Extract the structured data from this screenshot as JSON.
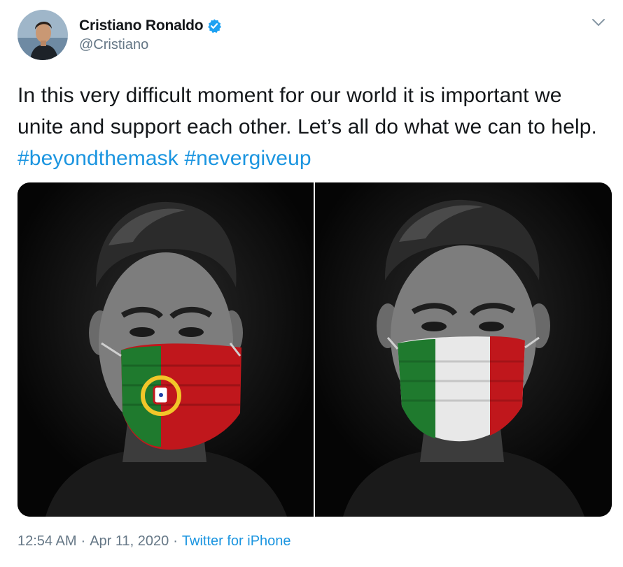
{
  "author": {
    "display_name": "Cristiano Ronaldo",
    "handle": "@Cristiano",
    "verified": true,
    "avatar_icon": "profile-photo"
  },
  "tweet": {
    "text_plain": "In this very difficult moment for our world it is important we unite and support each other. Let’s all do what we can to help. ",
    "hashtags": [
      "#beyondthemask",
      "#nevergiveup"
    ]
  },
  "media": [
    {
      "description_icon": "portrait-portugal-flag-mask",
      "flag": "Portugal"
    },
    {
      "description_icon": "portrait-italy-flag-mask",
      "flag": "Italy"
    }
  ],
  "meta": {
    "time": "12:54 AM",
    "date": "Apr 11, 2020",
    "separator": "·",
    "source": "Twitter for iPhone"
  },
  "colors": {
    "link": "#1b95e0",
    "secondary_text": "#657786",
    "verified_badge": "#1da1f2"
  }
}
